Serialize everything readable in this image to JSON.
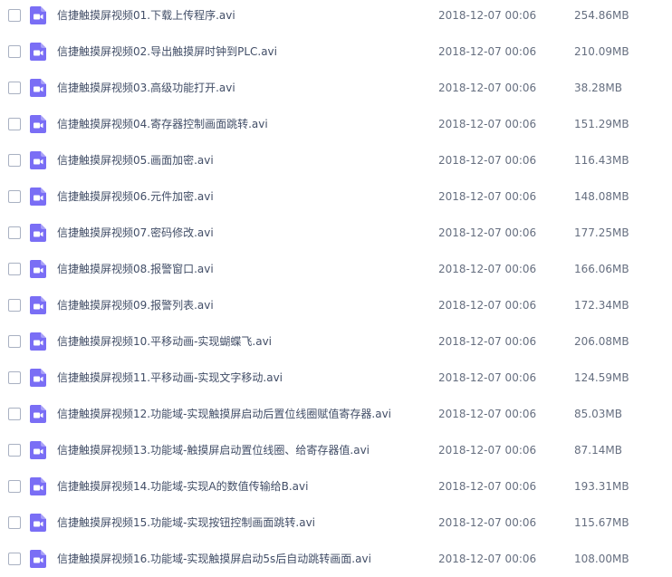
{
  "theme": {
    "icon_color": "#7a6ef5",
    "text_color": "#424e67",
    "meta_color": "#666f80",
    "checkbox_border": "#a9b1c2"
  },
  "files": [
    {
      "name": "信捷触摸屏视频01.下载上传程序.avi",
      "date": "2018-12-07 00:06",
      "size": "254.86MB",
      "icon": "video-file-icon"
    },
    {
      "name": "信捷触摸屏视频02.导出触摸屏时钟到PLC.avi",
      "date": "2018-12-07 00:06",
      "size": "210.09MB",
      "icon": "video-file-icon"
    },
    {
      "name": "信捷触摸屏视频03.高级功能打开.avi",
      "date": "2018-12-07 00:06",
      "size": "38.28MB",
      "icon": "video-file-icon"
    },
    {
      "name": "信捷触摸屏视频04.寄存器控制画面跳转.avi",
      "date": "2018-12-07 00:06",
      "size": "151.29MB",
      "icon": "video-file-icon"
    },
    {
      "name": "信捷触摸屏视频05.画面加密.avi",
      "date": "2018-12-07 00:06",
      "size": "116.43MB",
      "icon": "video-file-icon"
    },
    {
      "name": "信捷触摸屏视频06.元件加密.avi",
      "date": "2018-12-07 00:06",
      "size": "148.08MB",
      "icon": "video-file-icon"
    },
    {
      "name": "信捷触摸屏视频07.密码修改.avi",
      "date": "2018-12-07 00:06",
      "size": "177.25MB",
      "icon": "video-file-icon"
    },
    {
      "name": "信捷触摸屏视频08.报警窗口.avi",
      "date": "2018-12-07 00:06",
      "size": "166.06MB",
      "icon": "video-file-icon"
    },
    {
      "name": "信捷触摸屏视频09.报警列表.avi",
      "date": "2018-12-07 00:06",
      "size": "172.34MB",
      "icon": "video-file-icon"
    },
    {
      "name": "信捷触摸屏视频10.平移动画-实现蝴蝶飞.avi",
      "date": "2018-12-07 00:06",
      "size": "206.08MB",
      "icon": "video-file-icon"
    },
    {
      "name": "信捷触摸屏视频11.平移动画-实现文字移动.avi",
      "date": "2018-12-07 00:06",
      "size": "124.59MB",
      "icon": "video-file-icon"
    },
    {
      "name": "信捷触摸屏视频12.功能域-实现触摸屏启动后置位线圈赋值寄存器.avi",
      "date": "2018-12-07 00:06",
      "size": "85.03MB",
      "icon": "video-file-icon"
    },
    {
      "name": "信捷触摸屏视频13.功能域-触摸屏启动置位线圈、给寄存器值.avi",
      "date": "2018-12-07 00:06",
      "size": "87.14MB",
      "icon": "video-file-icon"
    },
    {
      "name": "信捷触摸屏视频14.功能域-实现A的数值传输给B.avi",
      "date": "2018-12-07 00:06",
      "size": "193.31MB",
      "icon": "video-file-icon"
    },
    {
      "name": "信捷触摸屏视频15.功能域-实现按钮控制画面跳转.avi",
      "date": "2018-12-07 00:06",
      "size": "115.67MB",
      "icon": "video-file-icon"
    },
    {
      "name": "信捷触摸屏视频16.功能域-实现触摸屏启动5s后自动跳转画面.avi",
      "date": "2018-12-07 00:06",
      "size": "108.00MB",
      "icon": "video-file-icon"
    }
  ]
}
